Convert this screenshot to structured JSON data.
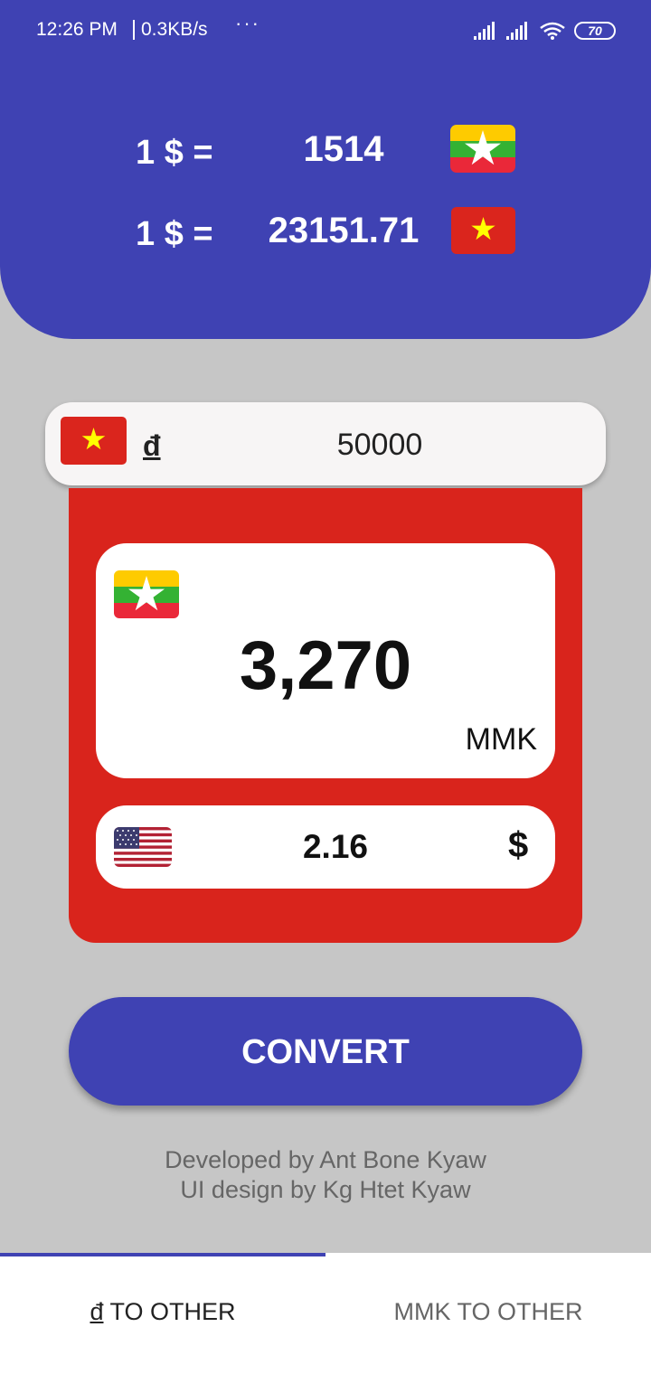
{
  "status_bar": {
    "time": "12:26 PM",
    "net_speed": "0.3KB/s",
    "more": "···",
    "battery": "70",
    "icons": [
      "signal-icon",
      "signal-icon",
      "wifi-icon",
      "battery-icon"
    ]
  },
  "rates": [
    {
      "label": "1 $ =",
      "value": "1514",
      "flag": "myanmar-flag-icon"
    },
    {
      "label": "1 $ =",
      "value": "23151.71",
      "flag": "vietnam-flag-icon"
    }
  ],
  "input": {
    "flag": "vietnam-flag-icon",
    "symbol": "đ",
    "value": "50000"
  },
  "result": {
    "mmk_flag": "myanmar-flag-icon",
    "mmk_value": "3,270",
    "mmk_unit": "MMK",
    "usd_flag": "usa-flag-icon",
    "usd_value": "2.16",
    "usd_symbol": "$"
  },
  "convert_label": "CONVERT",
  "credits": {
    "developer": "Developed by Ant Bone Kyaw",
    "designer": "UI design by Kg Htet Kyaw"
  },
  "tabs": [
    {
      "symbol": "đ",
      "label": " TO OTHER",
      "selected": true
    },
    {
      "label": "MMK TO OTHER",
      "selected": false
    }
  ],
  "colors": {
    "primary": "#3f42b3",
    "panel_red": "#d9241c",
    "background": "#c6c6c6",
    "vietnam_red": "#da251d",
    "vietnam_star": "#ffff00",
    "myanmar_yellow": "#fecb00",
    "myanmar_green": "#34b233",
    "myanmar_red": "#ea2839"
  }
}
